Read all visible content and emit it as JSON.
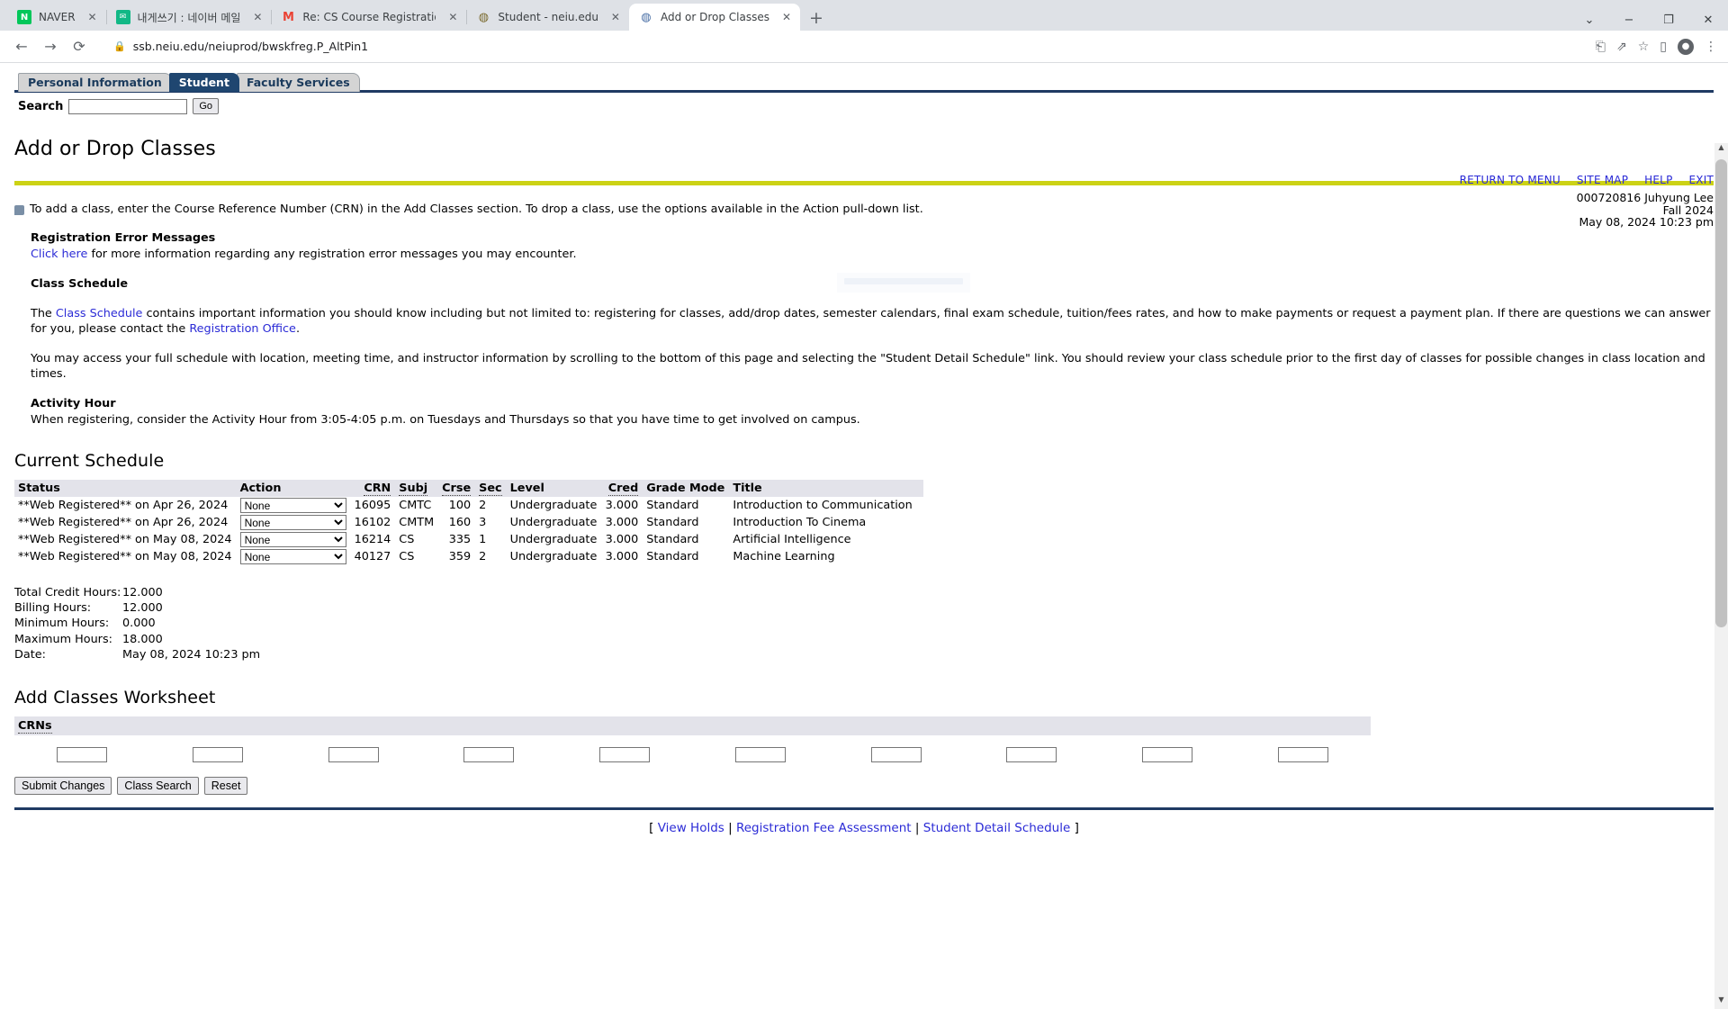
{
  "browser": {
    "tabs": [
      {
        "title": "NAVER",
        "favicon": "naver-icon",
        "active": false
      },
      {
        "title": "내게쓰기 : 네이버 메일",
        "favicon": "naver-mail-icon",
        "active": false
      },
      {
        "title": "Re: CS Course Registration Requ",
        "favicon": "gmail-icon",
        "active": false
      },
      {
        "title": "Student - neiu.edu",
        "favicon": "globe-icon",
        "active": false
      },
      {
        "title": "Add or Drop Classes",
        "favicon": "page-icon",
        "active": true
      }
    ],
    "close_label": "✕",
    "newtab_label": "+",
    "window_controls": [
      "⌄",
      "−",
      "❐",
      "✕"
    ],
    "back_label": "←",
    "forward_label": "→",
    "reload_label": "⟳",
    "lock_icon": "🔒",
    "url": "ssb.neiu.edu/neiuprod/bwskfreg.P_AltPin1",
    "omni_actions": [
      "translate-icon",
      "share-icon",
      "bookmark-star-icon",
      "sidepanel-icon",
      "profile-icon",
      "menu-icon"
    ]
  },
  "banner": {
    "tabs": [
      {
        "label": "Personal Information",
        "selected": false
      },
      {
        "label": "Student",
        "selected": true
      },
      {
        "label": "Faculty Services",
        "selected": false
      }
    ],
    "search_label": "Search",
    "search_value": "",
    "go_label": "Go",
    "util_links": [
      "RETURN TO MENU",
      "SITE MAP",
      "HELP",
      "EXIT"
    ],
    "user_id_name": "000720816 Juhyung Lee",
    "term": "Fall 2024",
    "timestamp": "May 08, 2024 10:23 pm"
  },
  "page": {
    "title": "Add or Drop Classes",
    "intro": "To add a class, enter the Course Reference Number (CRN) in the Add Classes section. To drop a class, use the options available in the Action pull-down list.",
    "error_heading": "Registration Error Messages",
    "error_link": "Click here",
    "error_text": " for more information regarding any registration error messages you may encounter.",
    "schedule_heading": "Class Schedule",
    "schedule_p1_a": "The ",
    "schedule_p1_link": "Class Schedule",
    "schedule_p1_b": " contains important information you should know including but not limited to: registering for classes, add/drop dates, semester calendars, final exam schedule, tuition/fees rates, and how to make payments or request a payment plan. If there are questions we can answer for you, please contact the ",
    "schedule_p1_link2": "Registration Office",
    "schedule_p1_c": ".",
    "schedule_p2": "You may access your full schedule with location, meeting time, and instructor information by scrolling to the bottom of this page and selecting the \"Student Detail Schedule\" link. You should review your class schedule prior to the first day of classes for possible changes in class location and times.",
    "activity_heading": "Activity Hour",
    "activity_text": "When registering, consider the Activity Hour from 3:05-4:05 p.m. on Tuesdays and Thursdays so that you have time to get involved on campus."
  },
  "current_schedule": {
    "heading": "Current Schedule",
    "columns": [
      "Status",
      "Action",
      "CRN",
      "Subj",
      "Crse",
      "Sec",
      "Level",
      "Cred",
      "Grade Mode",
      "Title"
    ],
    "action_selected": "None",
    "rows": [
      {
        "status": "**Web Registered** on Apr 26, 2024",
        "action": "None",
        "crn": "16095",
        "subj": "CMTC",
        "crse": "100",
        "sec": "2",
        "level": "Undergraduate",
        "cred": "3.000",
        "grade_mode": "Standard",
        "title": "Introduction to Communication"
      },
      {
        "status": "**Web Registered** on Apr 26, 2024",
        "action": "None",
        "crn": "16102",
        "subj": "CMTM",
        "crse": "160",
        "sec": "3",
        "level": "Undergraduate",
        "cred": "3.000",
        "grade_mode": "Standard",
        "title": "Introduction To Cinema"
      },
      {
        "status": "**Web Registered** on May 08, 2024",
        "action": "None",
        "crn": "16214",
        "subj": "CS",
        "crse": "335",
        "sec": "1",
        "level": "Undergraduate",
        "cred": "3.000",
        "grade_mode": "Standard",
        "title": "Artificial Intelligence"
      },
      {
        "status": "**Web Registered** on May 08, 2024",
        "action": "None",
        "crn": "40127",
        "subj": "CS",
        "crse": "359",
        "sec": "2",
        "level": "Undergraduate",
        "cred": "3.000",
        "grade_mode": "Standard",
        "title": "Machine Learning"
      }
    ]
  },
  "totals": [
    {
      "label": "Total Credit Hours:",
      "value": "12.000"
    },
    {
      "label": "Billing Hours:",
      "value": "12.000"
    },
    {
      "label": "Minimum Hours:",
      "value": "0.000"
    },
    {
      "label": "Maximum Hours:",
      "value": "18.000"
    },
    {
      "label": "Date:",
      "value": "May 08, 2024 10:23 pm"
    }
  ],
  "worksheet": {
    "heading": "Add Classes Worksheet",
    "crn_header": "CRNs",
    "crn_values": [
      "",
      "",
      "",
      "",
      "",
      "",
      "",
      "",
      "",
      ""
    ],
    "buttons": [
      "Submit Changes",
      "Class Search",
      "Reset"
    ]
  },
  "footer": {
    "open_bracket": "[",
    "close_bracket": "]",
    "links": [
      "View Holds",
      "Registration Fee Assessment",
      "Student Detail Schedule"
    ],
    "divider": "|"
  },
  "colors": {
    "navy": "#1f3a63",
    "yellow": "#ccd215",
    "link": "#2b2bd6",
    "tab_selected": "#1f4670"
  }
}
